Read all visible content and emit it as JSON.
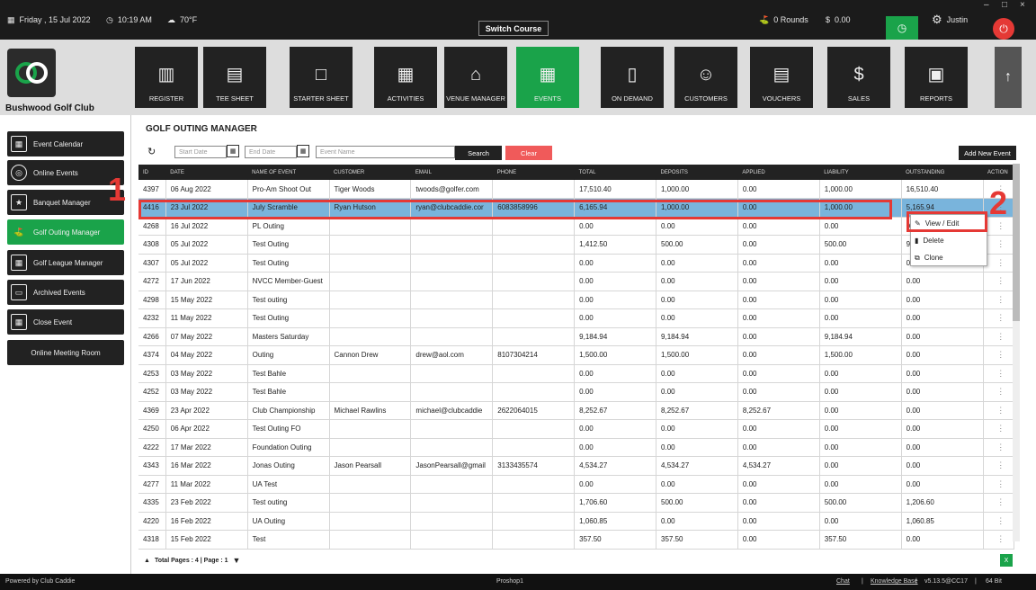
{
  "topbar": {
    "date": "Friday , 15 Jul 2022",
    "time": "10:19 AM",
    "weather": "70°F",
    "switch_course": "Switch Course",
    "rounds": "0 Rounds",
    "balance": "0.00",
    "user": "Justin"
  },
  "club_name": "Bushwood Golf Club",
  "nav": [
    {
      "label": "REGISTER",
      "icon": "register-icon"
    },
    {
      "label": "TEE SHEET",
      "icon": "tee-sheet-icon"
    },
    {
      "label": "STARTER SHEET",
      "icon": "starter-sheet-icon"
    },
    {
      "label": "ACTIVITIES",
      "icon": "calendar-icon"
    },
    {
      "label": "VENUE MANAGER",
      "icon": "venue-icon"
    },
    {
      "label": "EVENTS",
      "icon": "events-icon"
    },
    {
      "label": "ON DEMAND",
      "icon": "on-demand-icon"
    },
    {
      "label": "CUSTOMERS",
      "icon": "customers-icon"
    },
    {
      "label": "VOUCHERS",
      "icon": "vouchers-icon"
    },
    {
      "label": "SALES",
      "icon": "sales-icon"
    },
    {
      "label": "REPORTS",
      "icon": "reports-icon"
    }
  ],
  "sidebar": [
    {
      "label": "Event Calendar"
    },
    {
      "label": "Online Events"
    },
    {
      "label": "Banquet Manager"
    },
    {
      "label": "Golf Outing Manager"
    },
    {
      "label": "Golf League Manager"
    },
    {
      "label": "Archived Events"
    },
    {
      "label": "Close Event"
    },
    {
      "label": "Online Meeting Room"
    }
  ],
  "main": {
    "title": "GOLF OUTING MANAGER",
    "start_date": "Start Date",
    "end_date": "End Date",
    "event_name": "Event Name",
    "search": "Search",
    "clear": "Clear",
    "add_new": "Add New Event"
  },
  "columns": [
    "ID",
    "DATE",
    "NAME OF EVENT",
    "CUSTOMER",
    "EMAIL",
    "PHONE",
    "TOTAL",
    "DEPOSITS",
    "APPLIED",
    "LIABILITY",
    "OUTSTANDING",
    "ACTION"
  ],
  "rows": [
    [
      "4397",
      "06 Aug 2022",
      "Pro-Am Shoot Out",
      "Tiger Woods",
      "twoods@golfer.com",
      "",
      "17,510.40",
      "1,000.00",
      "0.00",
      "1,000.00",
      "16,510.40"
    ],
    [
      "4416",
      "23 Jul 2022",
      "July Scramble",
      "Ryan Hutson",
      "ryan@clubcaddie.cor",
      "6083858996",
      "6,165.94",
      "1,000.00",
      "0.00",
      "1,000.00",
      "5,165.94"
    ],
    [
      "4268",
      "16 Jul 2022",
      "PL Outing",
      "",
      "",
      "",
      "0.00",
      "0.00",
      "0.00",
      "0.00",
      "0.00"
    ],
    [
      "4308",
      "05 Jul 2022",
      "Test Outing",
      "",
      "",
      "",
      "1,412.50",
      "500.00",
      "0.00",
      "500.00",
      "912.50"
    ],
    [
      "4307",
      "05 Jul 2022",
      "Test Outing",
      "",
      "",
      "",
      "0.00",
      "0.00",
      "0.00",
      "0.00",
      "0.00"
    ],
    [
      "4272",
      "17 Jun 2022",
      "NVCC Member-Guest",
      "",
      "",
      "",
      "0.00",
      "0.00",
      "0.00",
      "0.00",
      "0.00"
    ],
    [
      "4298",
      "15 May 2022",
      "Test outing",
      "",
      "",
      "",
      "0.00",
      "0.00",
      "0.00",
      "0.00",
      "0.00"
    ],
    [
      "4232",
      "11 May 2022",
      "Test Outing",
      "",
      "",
      "",
      "0.00",
      "0.00",
      "0.00",
      "0.00",
      "0.00"
    ],
    [
      "4266",
      "07 May 2022",
      "Masters Saturday",
      "",
      "",
      "",
      "9,184.94",
      "9,184.94",
      "0.00",
      "9,184.94",
      "0.00"
    ],
    [
      "4374",
      "04 May 2022",
      "Outing",
      "Cannon Drew",
      "drew@aol.com",
      "8107304214",
      "1,500.00",
      "1,500.00",
      "0.00",
      "1,500.00",
      "0.00"
    ],
    [
      "4253",
      "03 May 2022",
      "Test Bahle",
      "",
      "",
      "",
      "0.00",
      "0.00",
      "0.00",
      "0.00",
      "0.00"
    ],
    [
      "4252",
      "03 May 2022",
      "Test Bahle",
      "",
      "",
      "",
      "0.00",
      "0.00",
      "0.00",
      "0.00",
      "0.00"
    ],
    [
      "4369",
      "23 Apr 2022",
      "Club Championship",
      "Michael Rawlins",
      "michael@clubcaddie",
      "2622064015",
      "8,252.67",
      "8,252.67",
      "8,252.67",
      "0.00",
      "0.00"
    ],
    [
      "4250",
      "06 Apr 2022",
      "Test Outing FO",
      "",
      "",
      "",
      "0.00",
      "0.00",
      "0.00",
      "0.00",
      "0.00"
    ],
    [
      "4222",
      "17 Mar 2022",
      "Foundation Outing",
      "",
      "",
      "",
      "0.00",
      "0.00",
      "0.00",
      "0.00",
      "0.00"
    ],
    [
      "4343",
      "16 Mar 2022",
      "Jonas Outing",
      "Jason Pearsall",
      "JasonPearsall@gmail",
      "3133435574",
      "4,534.27",
      "4,534.27",
      "4,534.27",
      "0.00",
      "0.00"
    ],
    [
      "4277",
      "11 Mar 2022",
      "UA Test",
      "",
      "",
      "",
      "0.00",
      "0.00",
      "0.00",
      "0.00",
      "0.00"
    ],
    [
      "4335",
      "23 Feb 2022",
      "Test outing",
      "",
      "",
      "",
      "1,706.60",
      "500.00",
      "0.00",
      "500.00",
      "1,206.60"
    ],
    [
      "4220",
      "16 Feb 2022",
      "UA Outing",
      "",
      "",
      "",
      "1,060.85",
      "0.00",
      "0.00",
      "0.00",
      "1,060.85"
    ],
    [
      "4318",
      "15 Feb 2022",
      "Test",
      "",
      "",
      "",
      "357.50",
      "357.50",
      "0.00",
      "357.50",
      "0.00"
    ]
  ],
  "context_menu": [
    "View / Edit",
    "Delete",
    "Clone"
  ],
  "annotations": [
    "1",
    "2"
  ],
  "pager": "Total Pages : 4 | Page : 1",
  "footer": {
    "powered": "Powered by Club Caddie",
    "station": "Proshop1",
    "chat": "Chat",
    "kb": "Knowledge Base",
    "version": "v5.13.5@CC17",
    "bits": "64 Bit",
    "sep": "|"
  },
  "colors": {
    "accent": "#1aa34a",
    "selected_row": "#79b4dc",
    "highlight": "#e53935"
  }
}
